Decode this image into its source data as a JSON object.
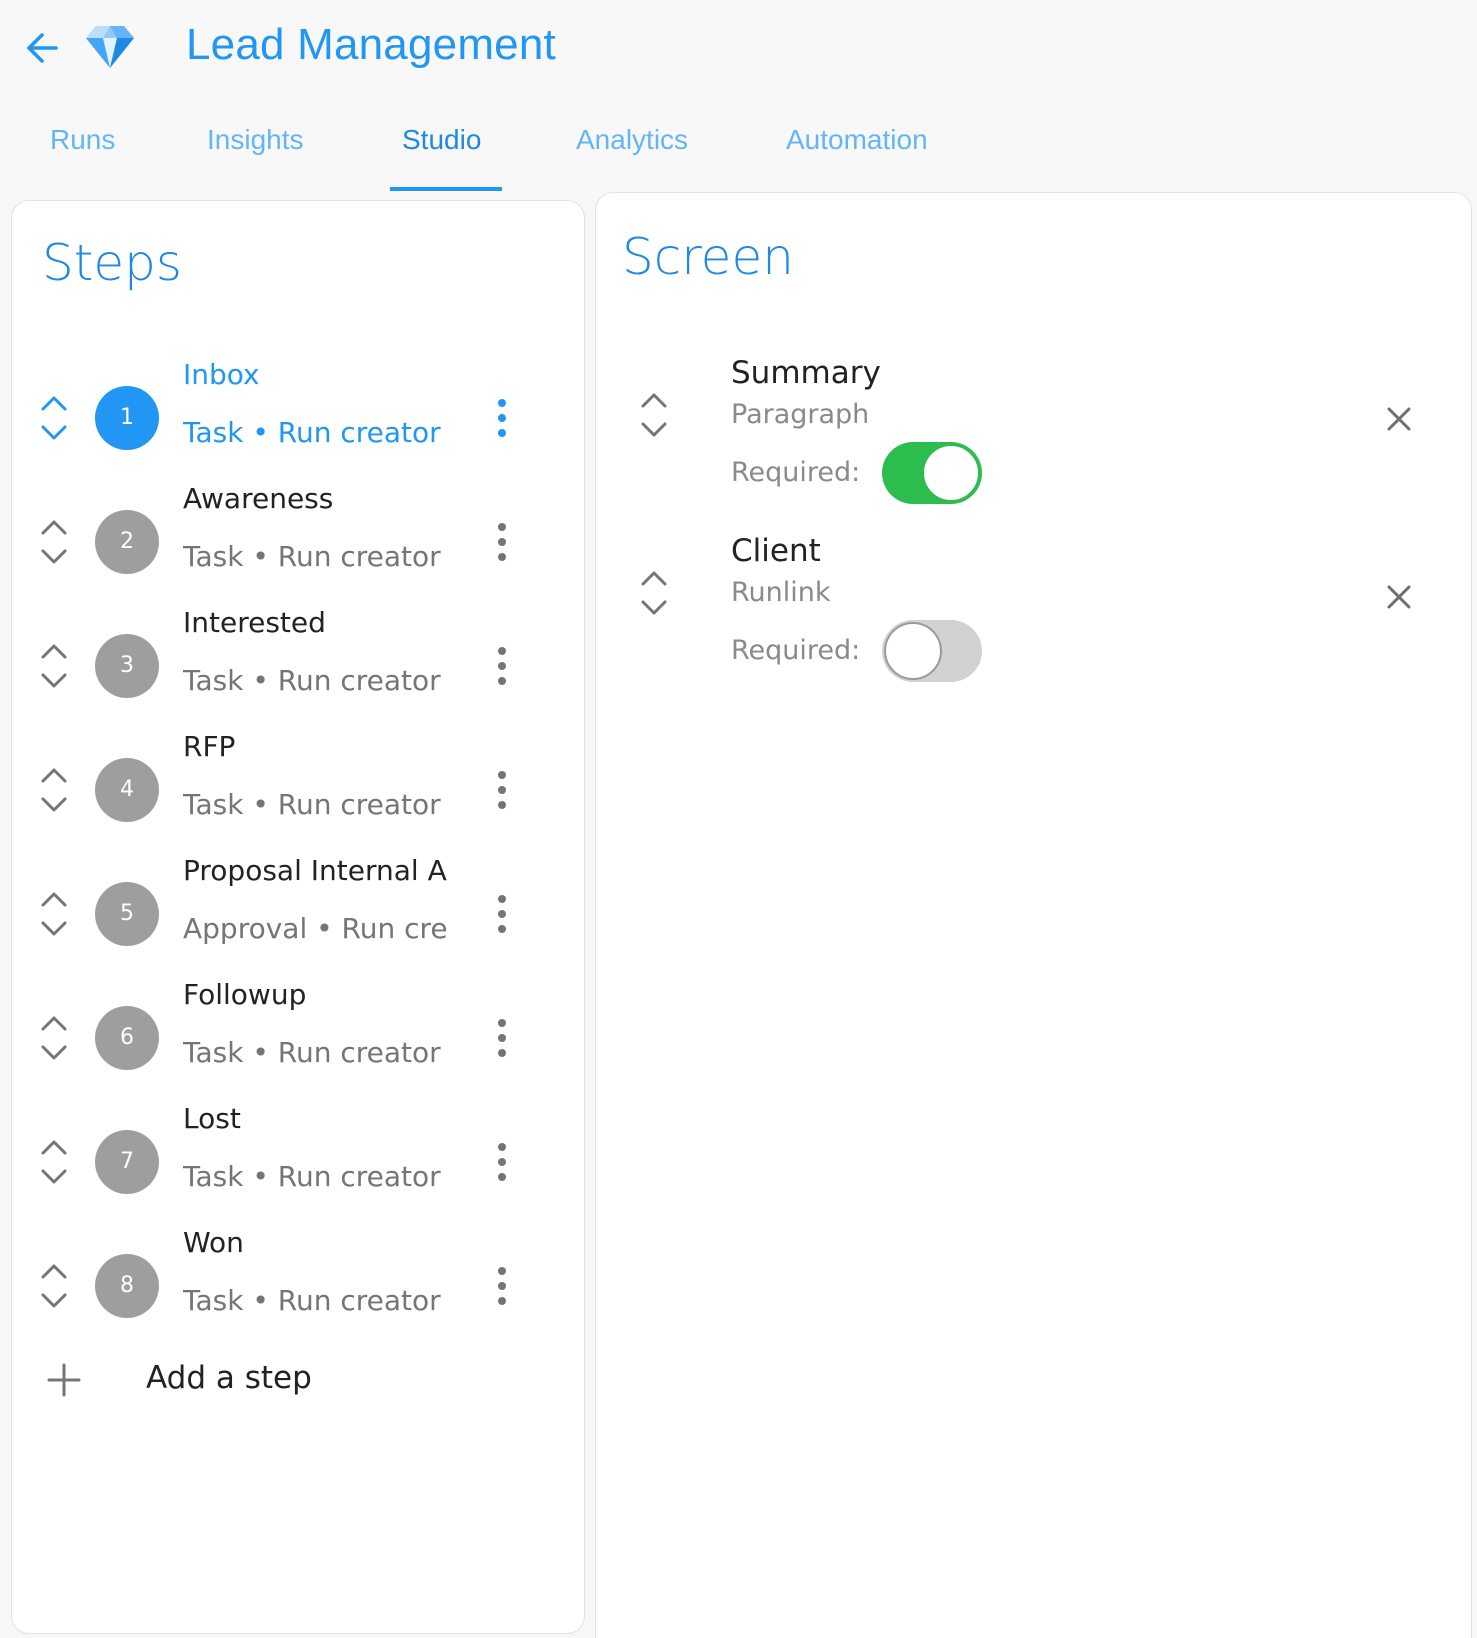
{
  "header": {
    "title": "Lead Management",
    "back_icon": "arrow-left-icon",
    "logo_icon": "diamond-icon"
  },
  "tabs": [
    {
      "label": "Runs",
      "active": false
    },
    {
      "label": "Insights",
      "active": false
    },
    {
      "label": "Studio",
      "active": true
    },
    {
      "label": "Analytics",
      "active": false
    },
    {
      "label": "Automation",
      "active": false
    }
  ],
  "steps_panel": {
    "title": "Steps",
    "items": [
      {
        "number": "1",
        "name": "Inbox",
        "subtitle": "Task • Run creator",
        "active": true
      },
      {
        "number": "2",
        "name": "Awareness",
        "subtitle": "Task • Run creator",
        "active": false
      },
      {
        "number": "3",
        "name": "Interested",
        "subtitle": "Task • Run creator",
        "active": false
      },
      {
        "number": "4",
        "name": "RFP",
        "subtitle": "Task • Run creator",
        "active": false
      },
      {
        "number": "5",
        "name": "Proposal Internal Ap",
        "subtitle": "Approval • Run crea",
        "active": false
      },
      {
        "number": "6",
        "name": "Followup",
        "subtitle": "Task • Run creator",
        "active": false
      },
      {
        "number": "7",
        "name": "Lost",
        "subtitle": "Task • Run creator",
        "active": false
      },
      {
        "number": "8",
        "name": "Won",
        "subtitle": "Task • Run creator",
        "active": false
      }
    ],
    "add_label": "Add a step"
  },
  "screen_panel": {
    "title": "Screen",
    "fields": [
      {
        "name": "Summary",
        "type": "Paragraph",
        "required_label": "Required:",
        "required": true
      },
      {
        "name": "Client",
        "type": "Runlink",
        "required_label": "Required:",
        "required": false
      }
    ]
  },
  "colors": {
    "accent": "#2196f3",
    "toggle_on": "#2dbd4e",
    "inactive_circle": "#9e9e9e"
  }
}
